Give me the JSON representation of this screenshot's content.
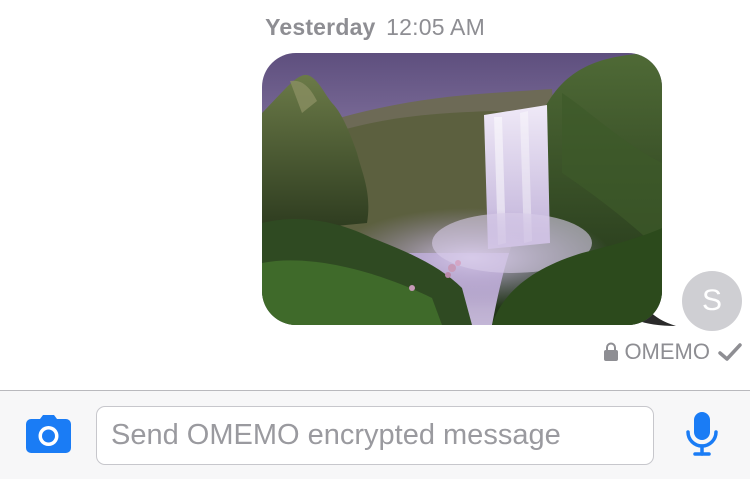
{
  "conversation": {
    "timestamp_day": "Yesterday",
    "timestamp_time": "12:05 AM",
    "message": {
      "type": "image",
      "image_subject": "waterfall-landscape-photo",
      "sender_avatar_initial": "S",
      "encryption_label": "OMEMO",
      "delivered": true
    }
  },
  "composer": {
    "placeholder": "Send OMEMO encrypted message",
    "value": "",
    "camera_icon": "camera-icon",
    "mic_icon": "microphone-icon"
  },
  "colors": {
    "accent": "#1a7cf5",
    "secondary_text": "#8e8e93",
    "avatar_bg": "#cfcfd3",
    "composer_bg": "#f7f7f8"
  }
}
